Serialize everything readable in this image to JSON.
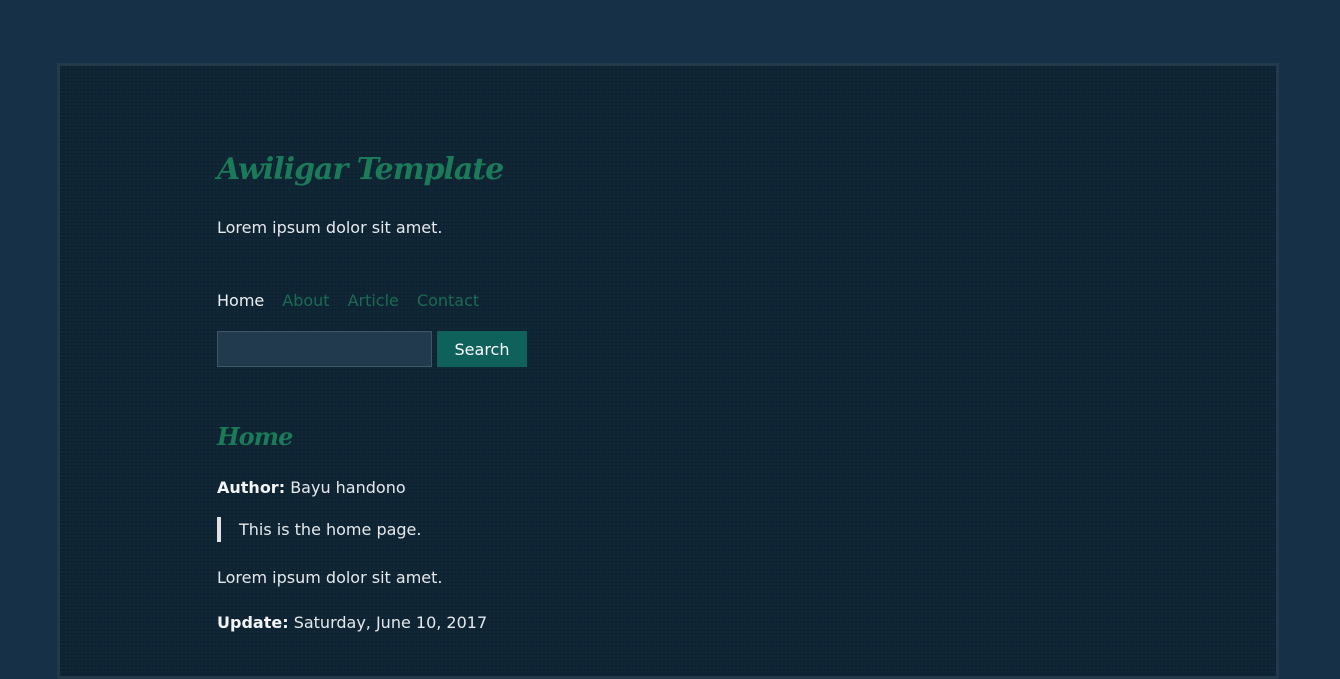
{
  "site": {
    "title": "Awiligar Template",
    "tagline": "Lorem ipsum dolor sit amet."
  },
  "nav": {
    "items": [
      {
        "label": "Home",
        "active": true
      },
      {
        "label": "About",
        "active": false
      },
      {
        "label": "Article",
        "active": false
      },
      {
        "label": "Contact",
        "active": false
      }
    ]
  },
  "search": {
    "value": "",
    "placeholder": "",
    "button_label": "Search"
  },
  "post": {
    "title": "Home",
    "author_label": "Author:",
    "author": "Bayu handono",
    "quote": "This is the home page.",
    "body": "Lorem ipsum dolor sit amet.",
    "update_label": "Update:",
    "update_date": "Saturday, June 10, 2017"
  },
  "colors": {
    "page_background": "#163147",
    "content_background": "#0f2535",
    "accent_green": "#1b7a58",
    "nav_link": "#1a6b52",
    "button_background": "#0f615c",
    "text": "#e6e9ec"
  }
}
